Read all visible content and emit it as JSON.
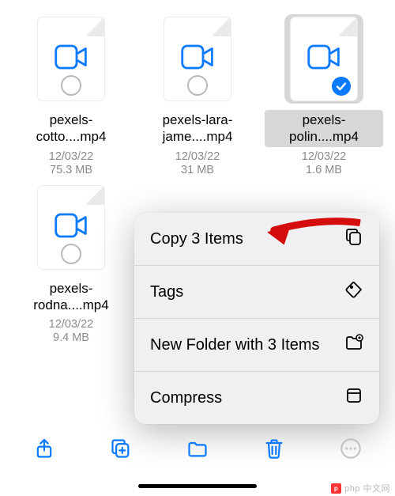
{
  "files": [
    {
      "name": "pexels-cotto....mp4",
      "date": "12/03/22",
      "size": "75.3 MB",
      "selected": false,
      "checked": false
    },
    {
      "name": "pexels-lara-jame....mp4",
      "date": "12/03/22",
      "size": "31 MB",
      "selected": false,
      "checked": false
    },
    {
      "name": "pexels-polin....mp4",
      "date": "12/03/22",
      "size": "1.6 MB",
      "selected": true,
      "checked": true
    },
    {
      "name": "pexels-rodna....mp4",
      "date": "12/03/22",
      "size": "9.4 MB",
      "selected": false,
      "checked": false
    }
  ],
  "menu": {
    "copy": "Copy 3 Items",
    "tags": "Tags",
    "new_folder": "New Folder with 3 Items",
    "compress": "Compress"
  },
  "colors": {
    "accent": "#0a7aff",
    "arrow": "#d40c0c"
  },
  "watermark": "php 中文网"
}
